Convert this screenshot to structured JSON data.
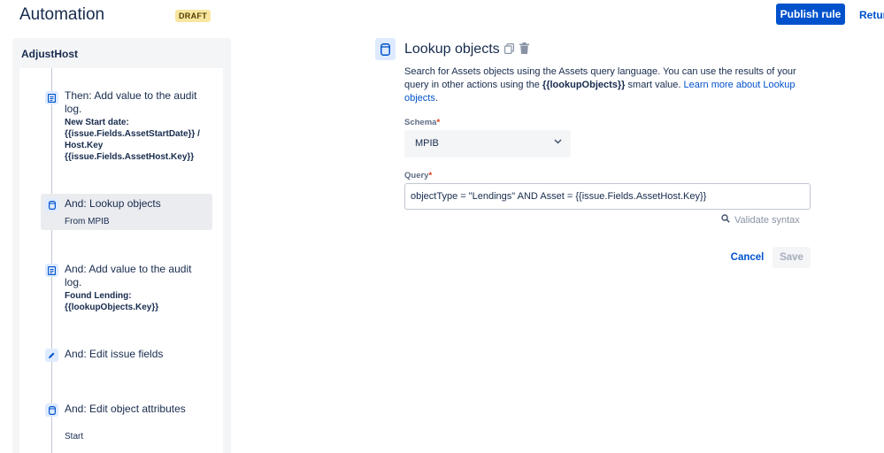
{
  "header": {
    "title": "Automation",
    "badge": "DRAFT",
    "publish_label": "Publish rule",
    "return_label": "Retur"
  },
  "rule": {
    "name": "AdjustHost",
    "steps": [
      {
        "icon": "audit-log-icon",
        "title": "Then: Add value to the audit log.",
        "detail": "New Start date: {{issue.Fields.AssetStartDate}} / Host.Key {{issue.Fields.AssetHost.Key}}"
      },
      {
        "icon": "database-icon",
        "title": "And: Lookup objects",
        "sub": "From MPIB",
        "selected": true
      },
      {
        "icon": "audit-log-icon",
        "title": "And: Add value to the audit log.",
        "detail": "Found Lending: {{lookupObjects.Key}}"
      },
      {
        "icon": "pencil-icon",
        "title": "And: Edit issue fields"
      },
      {
        "icon": "database-icon",
        "title": "And: Edit object attributes",
        "sub": "Start"
      }
    ]
  },
  "panel": {
    "title": "Lookup objects",
    "description_1": "Search for Assets objects using the Assets query language. You can use the results of your query in other actions using the",
    "description_code": "{{lookupObjects}}",
    "description_2": "smart value.",
    "description_link": "Learn more about Lookup objects",
    "description_end": ".",
    "schema": {
      "label": "Schema",
      "required": "*",
      "value": "MPIB"
    },
    "query": {
      "label": "Query",
      "required": "*",
      "value": "objectType = \"Lendings\" AND Asset = {{issue.Fields.AssetHost.Key}}"
    },
    "validate_label": "Validate syntax",
    "cancel_label": "Cancel",
    "save_label": "Save"
  },
  "colors": {
    "primary": "#0052cc",
    "badge_bg": "#f8e6a0",
    "icon_bg": "#deebff",
    "required": "#de350b"
  }
}
